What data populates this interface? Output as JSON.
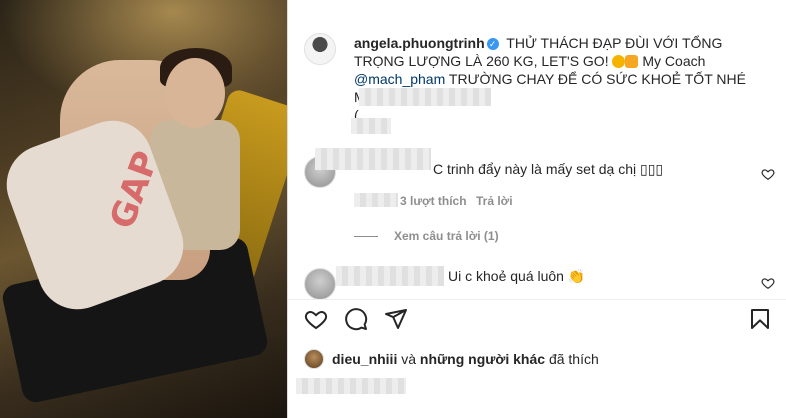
{
  "post": {
    "username": "angela.phuongtrinh",
    "caption_part1": "THỬ THÁCH ĐẠP ĐÙI VỚI TỔNG TRỌNG LƯỢNG LÀ 260 KG, LET'S GO!",
    "caption_part2": "My Coach",
    "mention": "@mach_pham",
    "caption_part3": "TRƯỜNG CHAY ĐỂ CÓ SỨC KHOẺ TỐT NHÉ MỌI NGƯỜI!",
    "caption_part4": "("
  },
  "photo": {
    "logo_text": "GAP"
  },
  "comments": [
    {
      "text": "C trinh đẩy này là mấy set dạ chị",
      "emoji_suffix": "▯▯▯",
      "likes_label": "3 lượt thích",
      "reply_label": "Trả lời"
    },
    {
      "text": "Ui c khoẻ quá luôn",
      "emoji_suffix": "👏"
    }
  ],
  "view_replies": "Xem câu trả lời (1)",
  "likes": {
    "user": "dieu_nhiii",
    "rest": "và",
    "others": "những người khác",
    "suffix": "đã thích"
  },
  "icons": {
    "like": "heart-icon",
    "comment": "comment-icon",
    "share": "share-icon",
    "save": "bookmark-icon"
  },
  "colors": {
    "verified": "#3897f0",
    "mention": "#00376b",
    "muted": "#8e8e8e"
  }
}
